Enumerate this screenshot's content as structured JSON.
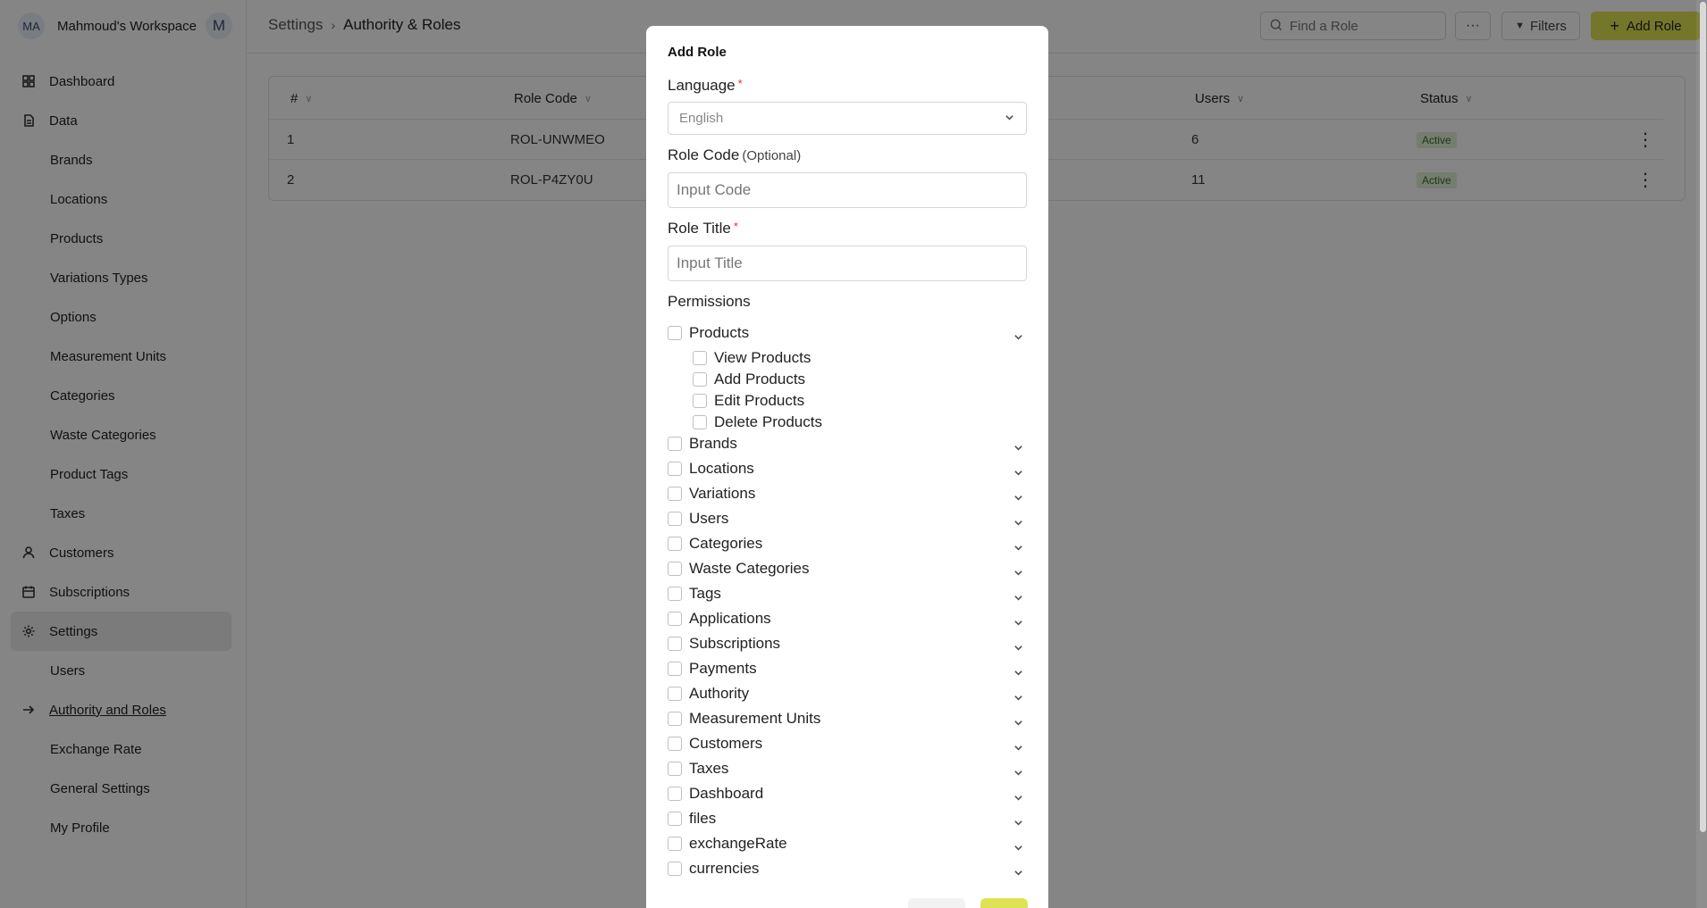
{
  "workspace": {
    "initials": "MA",
    "name": "Mahmoud's Workspace",
    "badge": "M"
  },
  "sidebar": {
    "items": [
      {
        "label": "Dashboard",
        "icon": "dashboard-icon"
      },
      {
        "label": "Data",
        "icon": "document-icon"
      },
      {
        "label": "Brands"
      },
      {
        "label": "Locations"
      },
      {
        "label": "Products"
      },
      {
        "label": "Variations Types"
      },
      {
        "label": "Options"
      },
      {
        "label": "Measurement Units"
      },
      {
        "label": "Categories"
      },
      {
        "label": "Waste Categories"
      },
      {
        "label": "Product Tags"
      },
      {
        "label": "Taxes"
      },
      {
        "label": "Customers",
        "icon": "user-icon"
      },
      {
        "label": "Subscriptions",
        "icon": "calendar-icon"
      },
      {
        "label": "Settings",
        "icon": "gear-icon"
      },
      {
        "label": "Users"
      },
      {
        "label": "Authority and Roles",
        "icon": "arrow-right-icon"
      },
      {
        "label": "Exchange Rate"
      },
      {
        "label": "General Settings"
      },
      {
        "label": "My Profile"
      }
    ]
  },
  "header": {
    "breadcrumb": [
      "Settings",
      "Authority & Roles"
    ],
    "search_placeholder": "Find a Role",
    "more_label": "···",
    "filters_label": "Filters",
    "add_label": "Add Role"
  },
  "table": {
    "columns": [
      "#",
      "Role Code",
      "Users",
      "Status"
    ],
    "rows": [
      {
        "num": "1",
        "code": "ROL-UNWMEO",
        "users": "6",
        "status": "Active"
      },
      {
        "num": "2",
        "code": "ROL-P4ZY0U",
        "users": "11",
        "status": "Active"
      }
    ]
  },
  "modal": {
    "title": "Add Role",
    "language_label": "Language",
    "language_value": "English",
    "code_label": "Role Code",
    "code_optional": "(Optional)",
    "code_placeholder": "Input Code",
    "title_label": "Role Title",
    "title_placeholder": "Input Title",
    "required_mark": "*",
    "permissions_label": "Permissions",
    "products_group": "Products",
    "product_children": [
      "View Products",
      "Add Products",
      "Edit Products",
      "Delete Products"
    ],
    "groups": [
      "Brands",
      "Locations",
      "Variations",
      "Users",
      "Categories",
      "Waste Categories",
      "Tags",
      "Applications",
      "Subscriptions",
      "Payments",
      "Authority",
      "Measurement Units",
      "Customers",
      "Taxes",
      "Dashboard",
      "files",
      "exchangeRate",
      "currencies"
    ]
  },
  "colors": {
    "accent": "#dfe353",
    "badge_bg": "#dff0d5",
    "badge_text": "#3d6b2b",
    "overlay": "rgba(0,0,0,0.48)"
  }
}
